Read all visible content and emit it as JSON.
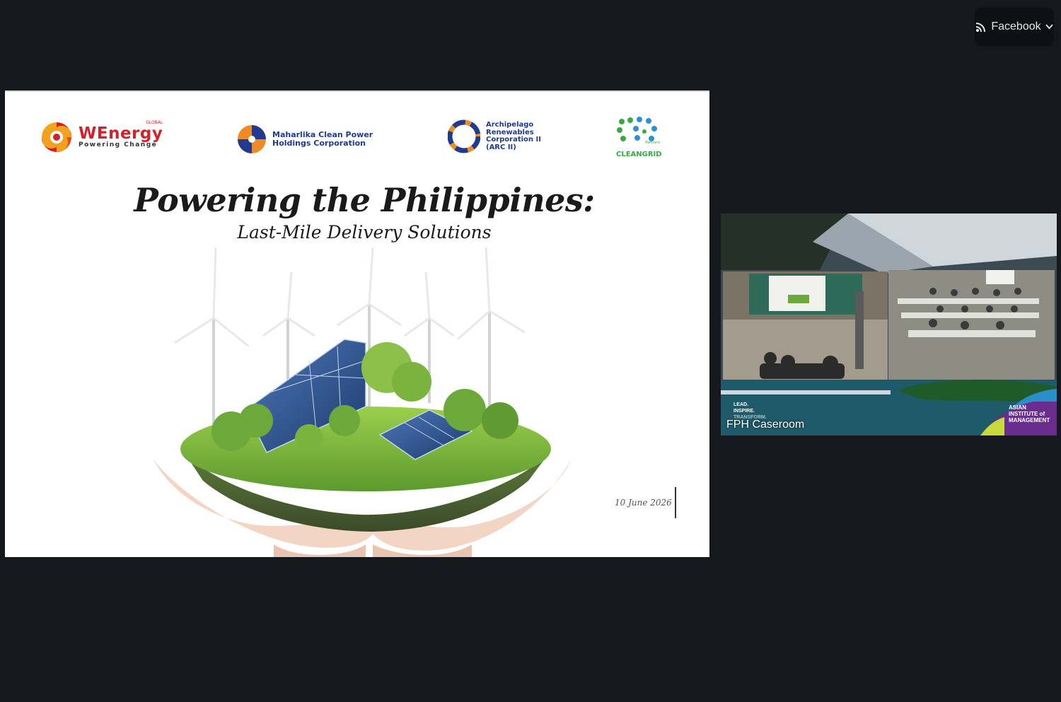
{
  "stream": {
    "label": "Facebook",
    "icon": "live-feed-icon",
    "chevron": "chevron-down-icon"
  },
  "slide": {
    "logos": {
      "wenergy": {
        "name": "WEnergy",
        "tag": "GLOBAL",
        "sub": "Powering Change"
      },
      "maharlika": {
        "line1": "Maharlika Clean Power",
        "line2": "Holdings Corporation"
      },
      "arc": {
        "line1": "Archipelago",
        "line2": "Renewables",
        "line3": "Corporation II",
        "line4": "(ARC II)"
      },
      "cleangrid": {
        "top": "Partners",
        "name": "CLEANGRID"
      }
    },
    "title": "Powering the Philippines:",
    "subtitle": "Last-Mile Delivery Solutions",
    "date": "10 June 2026"
  },
  "video": {
    "label": "FPH Caseroom",
    "tagline": [
      "LEAD.",
      "INSPIRE.",
      "TRANSFORM."
    ],
    "institute": [
      "ASIAN",
      "INSTITUTE of",
      "MANAGEMENT"
    ]
  },
  "colors": {
    "background": "#15181c",
    "wenergy_red": "#d4202a",
    "maharlika_blue": "#1f3a8f",
    "maharlika_orange": "#f08a24",
    "cleangrid_green": "#3aa845",
    "cleangrid_blue": "#2d8fd6"
  }
}
